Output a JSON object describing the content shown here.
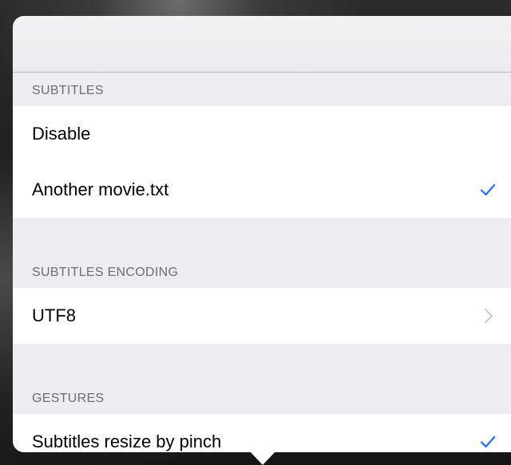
{
  "sections": [
    {
      "header": "SUBTITLES",
      "rows": [
        {
          "label": "Disable",
          "accessory": "none"
        },
        {
          "label": "Another movie.txt",
          "accessory": "checkmark-icon"
        }
      ]
    },
    {
      "header": "SUBTITLES ENCODING",
      "rows": [
        {
          "label": "UTF8",
          "accessory": "chevron-right-icon"
        }
      ]
    },
    {
      "header": "GESTURES",
      "rows": [
        {
          "label": "Subtitles resize by pinch",
          "accessory": "checkmark-icon"
        }
      ]
    }
  ],
  "colors": {
    "tint": "#1a6ef5",
    "chevron": "#c7c7cc",
    "section_text": "#6d6d72",
    "group_background": "#ededf1"
  }
}
